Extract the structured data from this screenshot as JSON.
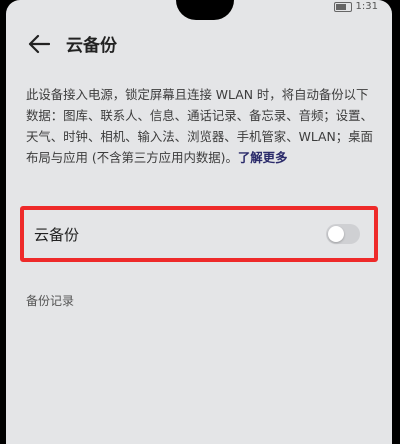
{
  "status": {
    "left": "",
    "time": "1:31"
  },
  "header": {
    "title": "云备份"
  },
  "description": {
    "text": "此设备接入电源，锁定屏幕且连接 WLAN 时，将自动备份以下数据：图库、联系人、信息、通话记录、备忘录、音频；设置、天气、时钟、相机、输入法、浏览器、手机管家、WLAN；桌面布局与应用 (不含第三方应用内数据)。",
    "link": "了解更多"
  },
  "cloud_backup": {
    "label": "云备份",
    "enabled": false
  },
  "backup_records": {
    "label": "备份记录"
  },
  "colors": {
    "highlight_border": "#ee2a2a",
    "background": "#e4e5e7"
  }
}
